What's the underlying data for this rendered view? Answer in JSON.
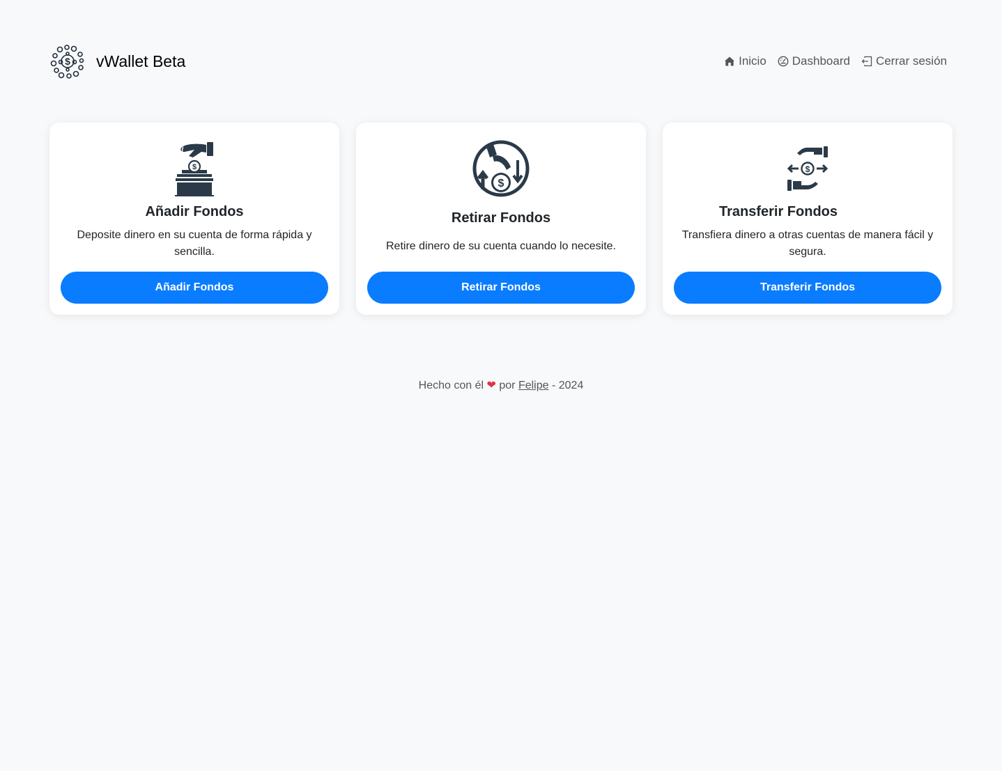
{
  "header": {
    "brand_name": "vWallet Beta",
    "logo_icon": "money-cluster-logo",
    "nav": [
      {
        "label": "Inicio",
        "icon": "house-icon"
      },
      {
        "label": "Dashboard",
        "icon": "speedometer-icon"
      },
      {
        "label": "Cerrar sesión",
        "icon": "sign-out-icon"
      }
    ]
  },
  "cards": [
    {
      "icon": "deposit-box-icon",
      "title": "Añadir Fondos",
      "description": "Deposite dinero en su cuenta de forma rápida y sencilla.",
      "button_label": "Añadir Fondos"
    },
    {
      "icon": "withdraw-coin-icon",
      "title": "Retirar Fondos",
      "description": "Retire dinero de su cuenta cuando lo necesite.",
      "button_label": "Retirar Fondos"
    },
    {
      "icon": "transfer-hands-icon",
      "title": "Transferir Fondos",
      "description": "Transfiera dinero a otras cuentas de manera fácil y segura.",
      "button_label": "Transferir Fondos"
    }
  ],
  "footer": {
    "prefix": "Hecho con él",
    "heart": "❤",
    "middle": "por",
    "author": "Felipe",
    "suffix": "- 2024"
  },
  "colors": {
    "background": "#f8f9fa",
    "primary_button": "#0a7cff",
    "heart": "#dc3545",
    "icon": "#2b3a48"
  }
}
